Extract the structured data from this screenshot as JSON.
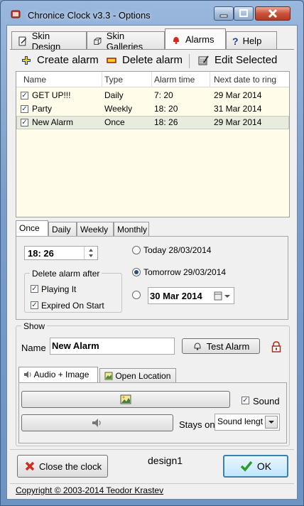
{
  "window": {
    "title": "Chronice Clock v3.3  -  Options"
  },
  "tabs": [
    {
      "label": "Skin Design",
      "icon": "pencil-icon"
    },
    {
      "label": "Skin Galleries",
      "icon": "cube-icon"
    },
    {
      "label": "Alarms",
      "icon": "bell-icon"
    },
    {
      "label": "Help",
      "icon": "question-icon"
    }
  ],
  "toolbar": {
    "create": "Create alarm",
    "delete": "Delete alarm",
    "edit": "Edit Selected"
  },
  "alarm_list": {
    "columns": [
      "Name",
      "Type",
      "Alarm time",
      "Next date to ring"
    ],
    "rows": [
      {
        "checked": true,
        "name": "GET UP!!!",
        "type": "Daily",
        "time": "7: 20",
        "next": "29 Mar 2014"
      },
      {
        "checked": true,
        "name": "Party",
        "type": "Weekly",
        "time": "18: 20",
        "next": "31 Mar 2014"
      },
      {
        "checked": true,
        "name": "New Alarm",
        "type": "Once",
        "time": "18: 26",
        "next": "29 Mar 2014"
      }
    ]
  },
  "schedule_tabs": [
    "Once",
    "Daily",
    "Weekly",
    "Monthly"
  ],
  "once": {
    "time": "18: 26",
    "delete_group_title": "Delete alarm after",
    "playing_it": "Playing It",
    "expired_on_start": "Expired On Start",
    "today": "Today 28/03/2014",
    "tomorrow": "Tomorrow 29/03/2014",
    "date": "30 Mar 2014"
  },
  "show": {
    "group_title": "Show",
    "name_label": "Name",
    "name_value": "New Alarm",
    "test_button": "Test Alarm"
  },
  "media_tabs": [
    "Audio + Image",
    "Open Location"
  ],
  "media": {
    "sound_label": "Sound",
    "stays_on_label": "Stays on",
    "stays_on_value": "Sound lengt"
  },
  "footer": {
    "close_button": "Close the clock",
    "design": "design1",
    "ok_button": "OK",
    "copyright": "Copyright © 2003-2014  Teodor Krastev"
  },
  "colors": {
    "accent_red": "#c8321e",
    "ok_green": "#2f9a2a",
    "list_bg": "#fffcea"
  }
}
